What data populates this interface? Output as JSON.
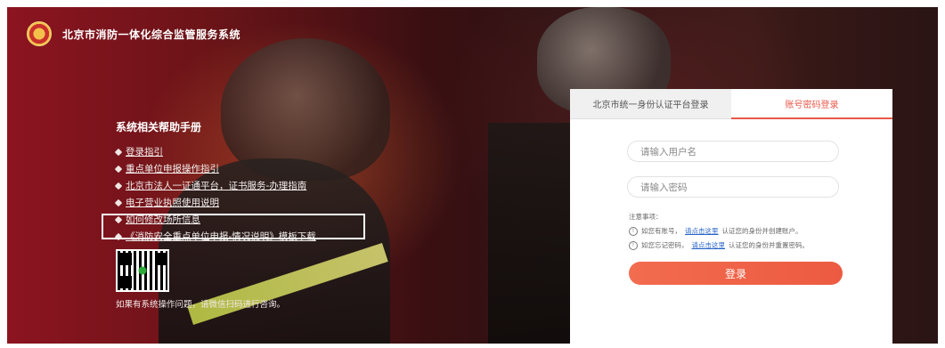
{
  "header": {
    "title": "北京市消防一体化综合监管服务系统"
  },
  "help": {
    "title": "系统相关帮助手册",
    "items": [
      {
        "label": "登录指引"
      },
      {
        "label": "重点单位申报操作指引"
      },
      {
        "label": "北京市法人一证通平台，证书服务-办理指南"
      },
      {
        "label": "电子营业执照使用说明"
      },
      {
        "label": "如何修改场所信息"
      },
      {
        "label": "《消防安全重点单位申报-情况说明》模板下载"
      }
    ],
    "qr_note": "如果有系统操作问题，请微信扫码进行咨询。"
  },
  "login": {
    "tabs": [
      {
        "label": "北京市统一身份认证平台登录",
        "active": false
      },
      {
        "label": "账号密码登录",
        "active": true
      }
    ],
    "username_placeholder": "请输入用户名",
    "password_placeholder": "请输入密码",
    "notes_title": "注意事项：",
    "notes": [
      {
        "prefix": "如您有账号，",
        "link": "请点击这里",
        "suffix": "认证您的身份并创建账户。"
      },
      {
        "prefix": "如您忘记密码，",
        "link": "请点击这里",
        "suffix": "认证您的身份并重置密码。"
      }
    ],
    "button_label": "登录"
  },
  "colors": {
    "accent": "#e8584a",
    "link": "#2a64c8",
    "background_red": "#8c1420"
  },
  "icons": {
    "logo": "fire-emblem-logo",
    "bullet": "diamond-bullet-icon",
    "info": "info-circle-icon"
  }
}
